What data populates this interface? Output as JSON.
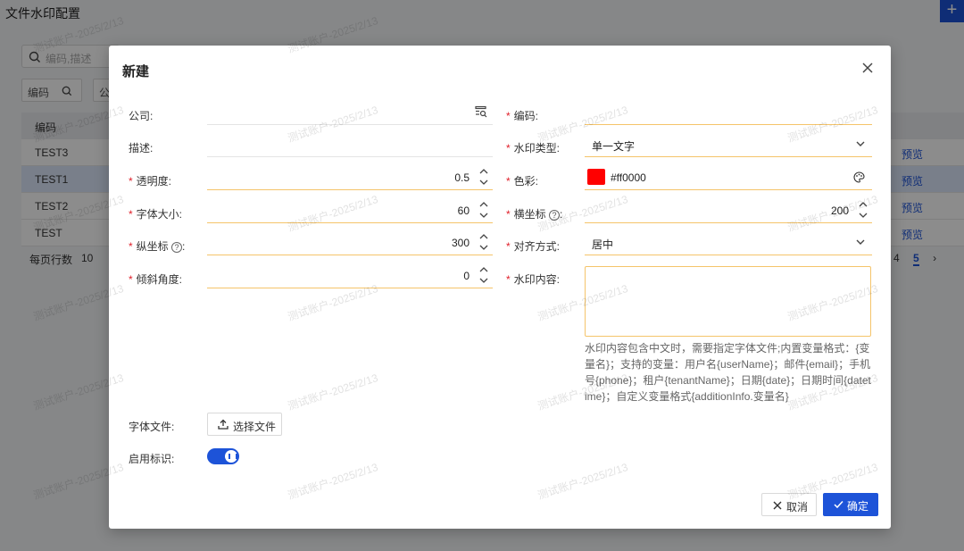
{
  "page": {
    "title": "文件水印配置",
    "add_button": "+",
    "search_placeholder": "编码,描述",
    "filters": [
      "编码",
      "公"
    ],
    "table": {
      "header": "编码",
      "rows": [
        "TEST3",
        "TEST1",
        "TEST2",
        "TEST"
      ],
      "preview_label": "预览"
    },
    "pager": {
      "rows_per_page_label": "每页行数",
      "rows_per_page": "10",
      "pages": [
        "4",
        "5"
      ],
      "current_page": "5"
    }
  },
  "modal": {
    "title": "新建",
    "fields": {
      "company_label": "公司:",
      "description_label": "描述:",
      "opacity_label": "透明度:",
      "opacity_value": "0.5",
      "font_size_label": "字体大小:",
      "font_size_value": "60",
      "y_coord_label": "纵坐标",
      "y_coord_value": "300",
      "tilt_label": "倾斜角度:",
      "tilt_value": "0",
      "code_label": "编码:",
      "type_label": "水印类型:",
      "type_value": "单一文字",
      "color_label": "色彩:",
      "color_value": "#ff0000",
      "x_coord_label": "横坐标",
      "x_coord_value": "200",
      "align_label": "对齐方式:",
      "align_value": "居中",
      "content_label": "水印内容:",
      "content_hint": "水印内容包含中文时，需要指定字体文件;内置变量格式：{变量名}；支持的变量：用户名{userName}；邮件{email}；手机号{phone}；租户{tenantName}；日期{date}；日期时间{datetime}；自定义变量格式{additionInfo.变量名}",
      "font_file_label": "字体文件:",
      "font_file_button": "选择文件",
      "enabled_label": "启用标识:",
      "enabled": true
    },
    "cancel_button": "取消",
    "ok_button": "确定"
  },
  "watermark_text": "测试账户-2025/2/13",
  "colors": {
    "primary": "#1d53d8",
    "required": "#e0202a",
    "required_border": "#f5c46a",
    "swatch": "#ff0000"
  }
}
